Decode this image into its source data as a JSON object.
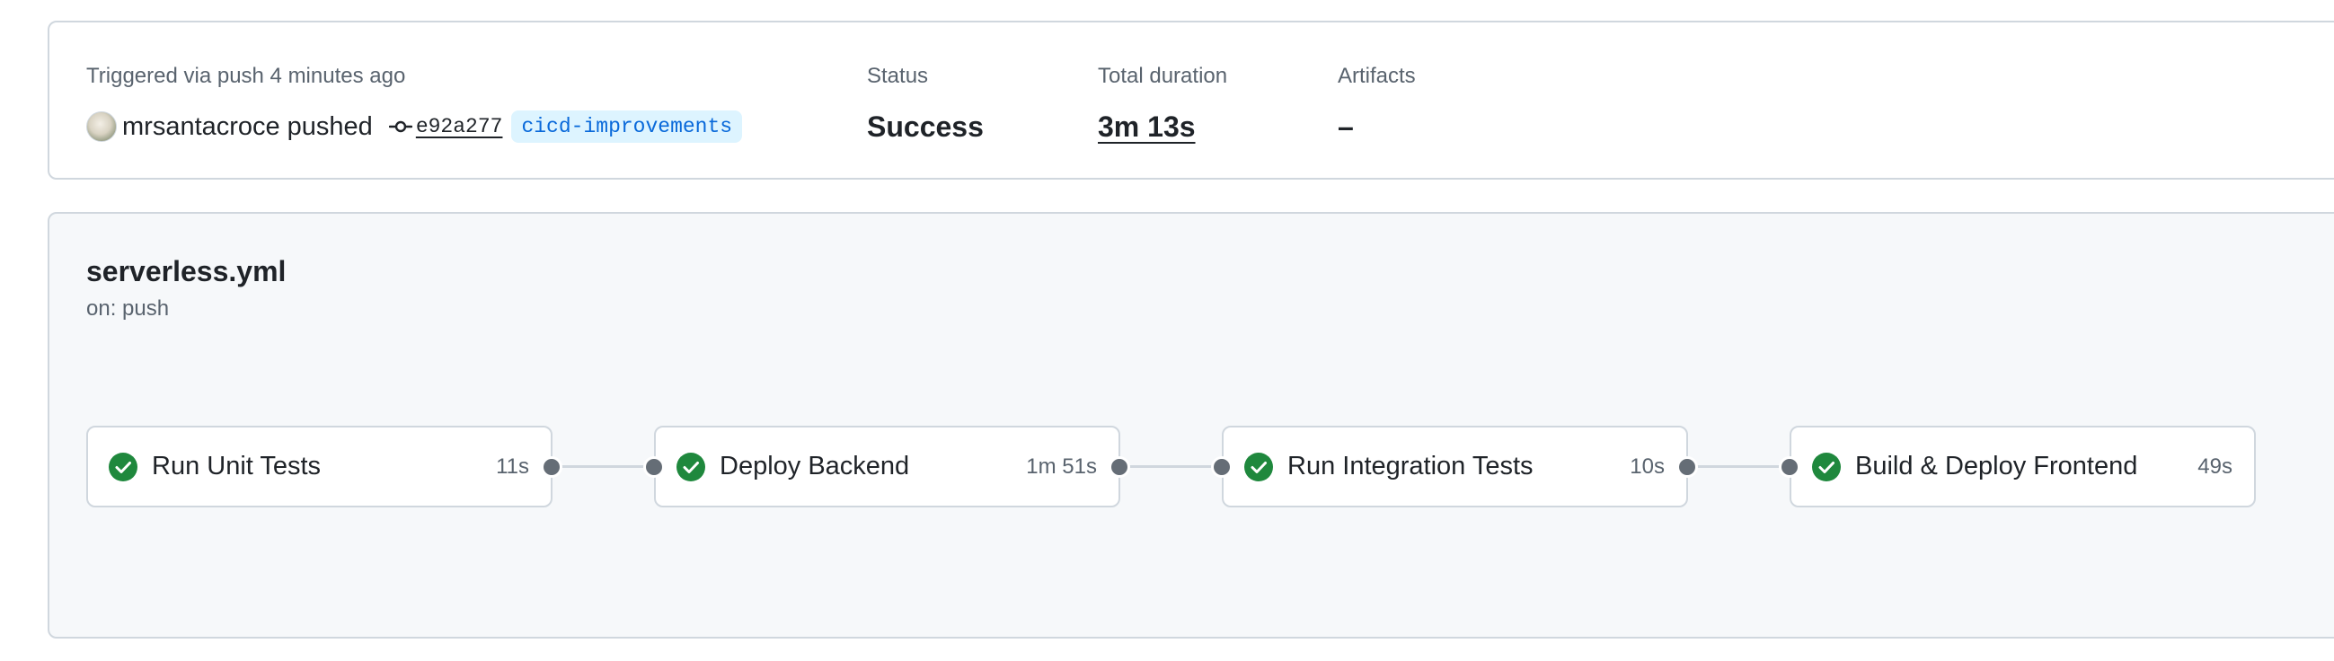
{
  "summary": {
    "trigger_label": "Triggered via push 4 minutes ago",
    "actor": "mrsantacroce",
    "action": "pushed",
    "commit_sha": "e92a277",
    "branch": "cicd-improvements",
    "status_label": "Status",
    "status_value": "Success",
    "duration_label": "Total duration",
    "duration_value": "3m 13s",
    "artifacts_label": "Artifacts",
    "artifacts_value": "–"
  },
  "workflow": {
    "file": "serverless.yml",
    "trigger": "on: push",
    "jobs": [
      {
        "name": "Run Unit Tests",
        "duration": "11s",
        "status": "success",
        "icon": "check-circle-icon"
      },
      {
        "name": "Deploy Backend",
        "duration": "1m 51s",
        "status": "success",
        "icon": "check-circle-icon"
      },
      {
        "name": "Run Integration Tests",
        "duration": "10s",
        "status": "success",
        "icon": "check-circle-icon"
      },
      {
        "name": "Build & Deploy Frontend",
        "duration": "49s",
        "status": "success",
        "icon": "check-circle-icon"
      }
    ]
  },
  "colors": {
    "success": "#1f883d",
    "link": "#0969da",
    "branch_bg": "#ddf4ff",
    "border": "#d0d7de",
    "muted": "#59636e",
    "canvas": "#f6f8fa"
  }
}
